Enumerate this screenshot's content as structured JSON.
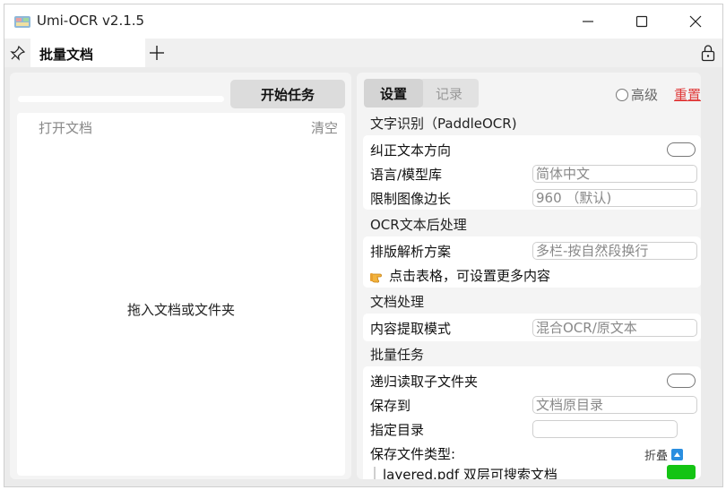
{
  "window": {
    "title": "Umi-OCR v2.1.5",
    "icon": "umi-app-icon"
  },
  "tabs": [
    {
      "label": "批量文档"
    }
  ],
  "left": {
    "progress": 0,
    "start_label": "开始任务",
    "open_doc_label": "打开文档",
    "clear_label": "清空",
    "drop_hint": "拖入文档或文件夹"
  },
  "right": {
    "tabs": [
      "设置",
      "记录"
    ],
    "advanced_label": "高级",
    "reset_label": "重置",
    "sections": {
      "ocr": {
        "title": "文字识别（PaddleOCR)",
        "rows": {
          "orientation": {
            "label": "纠正文本方向",
            "checked": false
          },
          "language": {
            "label": "语言/模型库",
            "value": "简体中文"
          },
          "limit": {
            "label": "限制图像边长",
            "value": "960 （默认)"
          }
        }
      },
      "post": {
        "title": "OCR文本后处理",
        "rows": {
          "layout": {
            "label": "排版解析方案",
            "value": "多栏-按自然段换行"
          },
          "hint": "点击表格，可设置更多内容"
        }
      },
      "doc": {
        "title": "文档处理",
        "rows": {
          "extract": {
            "label": "内容提取模式",
            "value": "混合OCR/原文本"
          }
        }
      },
      "batch": {
        "title": "批量任务",
        "rows": {
          "recurse": {
            "label": "递归读取子文件夹",
            "checked": false
          },
          "save_to": {
            "label": "保存到",
            "value": "文档原目录"
          },
          "custom_dir": {
            "label": "指定目录",
            "value": ""
          },
          "file_types": {
            "label": "保存文件类型:",
            "fold_label": "折叠"
          },
          "layered_pdf": {
            "label": "layered.pdf 双层可搜索文档",
            "checked": true
          }
        }
      }
    }
  },
  "colors": {
    "accent": "#2a8ee0",
    "reset": "#e03a3a",
    "switch_on": "#14c414"
  }
}
